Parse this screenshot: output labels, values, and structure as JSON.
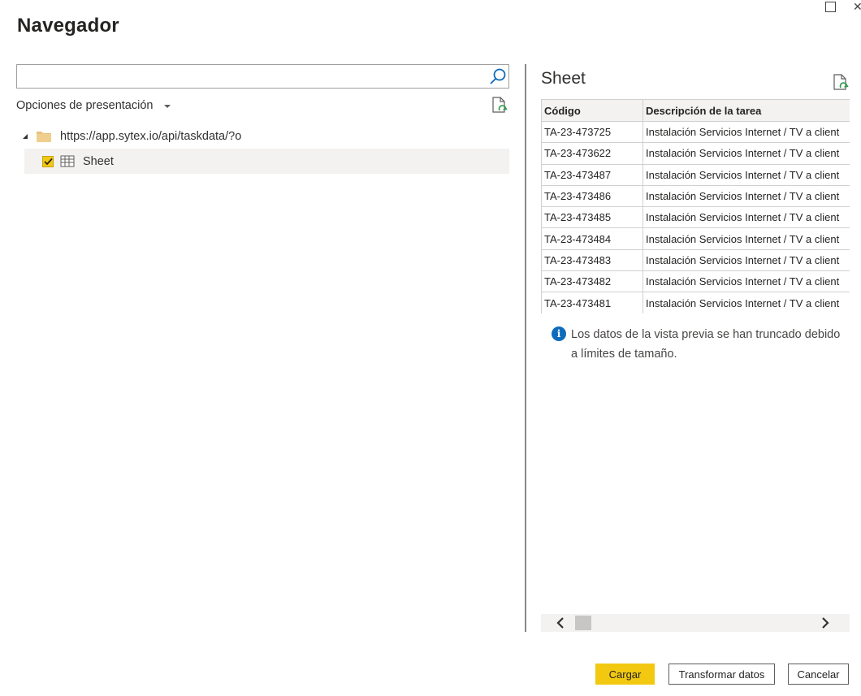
{
  "dialog": {
    "title": "Navegador"
  },
  "search": {
    "value": "",
    "placeholder": ""
  },
  "display_options": {
    "label": "Opciones de presentación"
  },
  "tree": {
    "root": {
      "label": "https://app.sytex.io/api/taskdata/?o",
      "icon": "folder-icon",
      "expanded": true
    },
    "items": [
      {
        "label": "Sheet",
        "icon": "table-icon",
        "checked": true,
        "selected": true
      }
    ]
  },
  "preview": {
    "title": "Sheet",
    "columns": [
      "Código",
      "Descripción de la tarea"
    ],
    "rows": [
      [
        "TA-23-473725",
        "Instalación Servicios Internet / TV a client"
      ],
      [
        "TA-23-473622",
        "Instalación Servicios Internet / TV a client"
      ],
      [
        "TA-23-473487",
        "Instalación Servicios Internet / TV a client"
      ],
      [
        "TA-23-473486",
        "Instalación Servicios Internet / TV a client"
      ],
      [
        "TA-23-473485",
        "Instalación Servicios Internet / TV a client"
      ],
      [
        "TA-23-473484",
        "Instalación Servicios Internet / TV a client"
      ],
      [
        "TA-23-473483",
        "Instalación Servicios Internet / TV a client"
      ],
      [
        "TA-23-473482",
        "Instalación Servicios Internet / TV a client"
      ],
      [
        "TA-23-473481",
        "Instalación Servicios Internet / TV a client"
      ]
    ],
    "info_message": "Los datos de la vista previa se han truncado debido a límites de tamaño."
  },
  "footer": {
    "load_label": "Cargar",
    "transform_label": "Transformar datos",
    "cancel_label": "Cancelar"
  },
  "colors": {
    "accent": "#f2c811",
    "info": "#0f6cbd"
  }
}
